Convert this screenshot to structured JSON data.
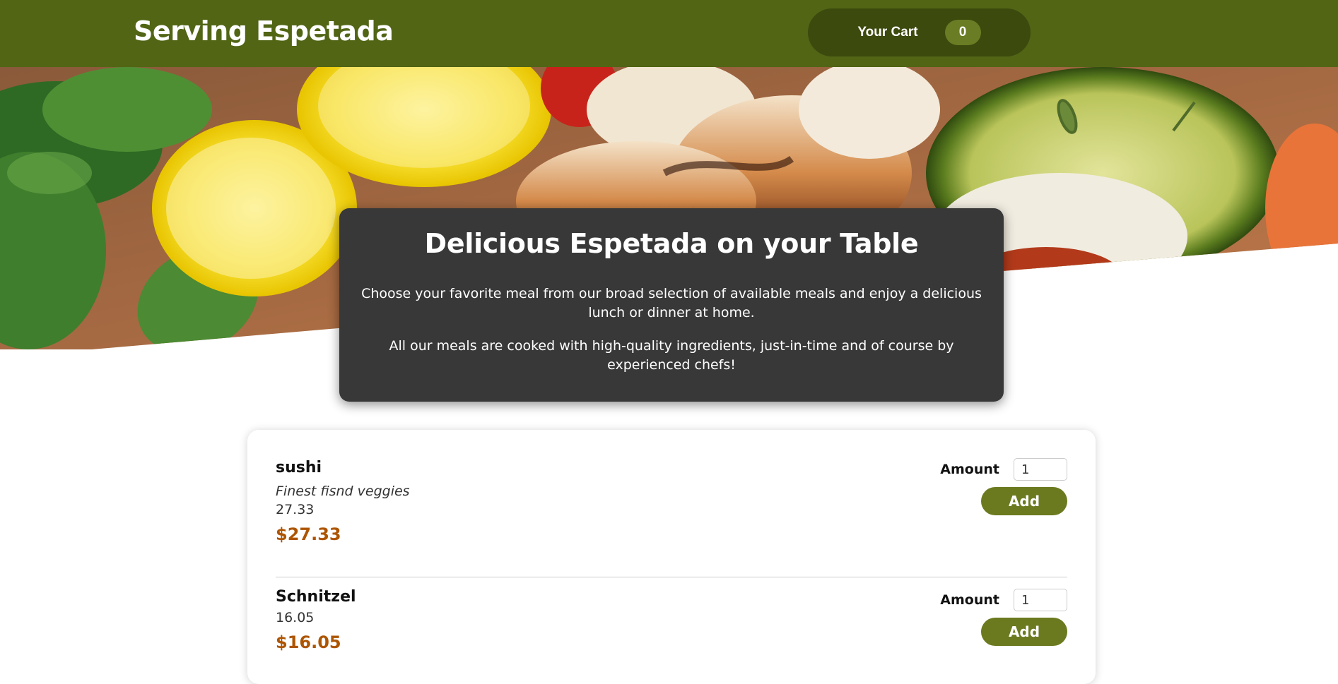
{
  "header": {
    "title": "Serving Espetada",
    "cart_label": "Your Cart",
    "cart_count": "0"
  },
  "hero": {
    "image": "grilled-espetada-skewers-with-lemon-and-zucchini"
  },
  "summary": {
    "heading": "Delicious Espetada on your Table",
    "paragraph_1": "Choose your favorite meal from our broad selection of available meals and enjoy a delicious lunch or dinner at home.",
    "paragraph_2": "All our meals are cooked with high-quality ingredients, just-in-time and of course by experienced chefs!"
  },
  "meals": [
    {
      "name": "sushi",
      "description": "Finest fisnd veggies",
      "raw_price": "27.33",
      "price": "$27.33",
      "amount_label": "Amount",
      "amount_value": "1",
      "add_label": "Add"
    },
    {
      "name": "Schnitzel",
      "description": "",
      "raw_price": "16.05",
      "price": "$16.05",
      "amount_label": "Amount",
      "amount_value": "1",
      "add_label": "Add"
    }
  ],
  "colors": {
    "header_bg": "#516515",
    "cart_bg": "#3c4a0e",
    "badge_bg": "#6a7d24",
    "summary_bg": "#383838",
    "price": "#ad5502",
    "add_button": "#6b7a1f"
  }
}
